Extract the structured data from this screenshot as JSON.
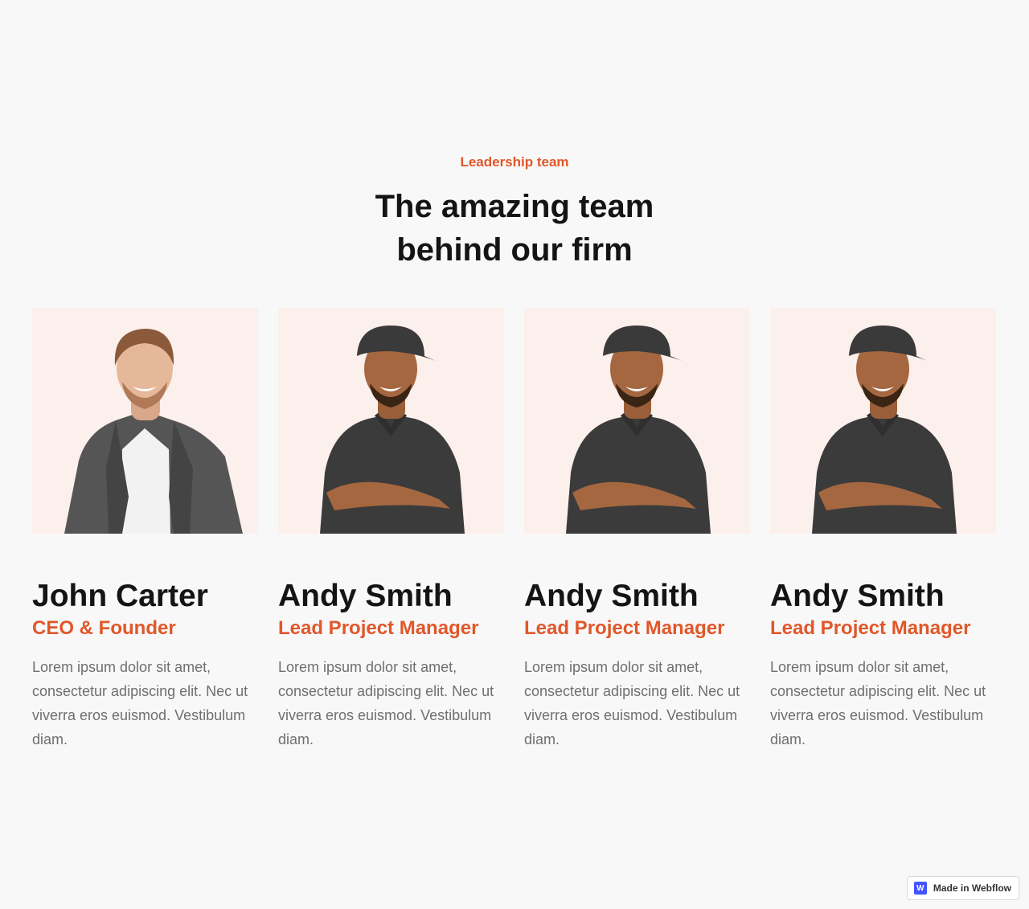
{
  "section": {
    "eyebrow": "Leadership team",
    "heading_line1": "The amazing team",
    "heading_line2": "behind our firm"
  },
  "members": [
    {
      "name": "John Carter",
      "role": "CEO & Founder",
      "bio": "Lorem ipsum dolor sit amet, consectetur adipiscing elit. Nec ut viverra eros euismod. Vestibulum diam.",
      "photo": "man-in-gray-blazer-photo"
    },
    {
      "name": "Andy Smith",
      "role": "Lead Project Manager",
      "bio": "Lorem ipsum dolor sit amet, consectetur adipiscing elit. Nec ut viverra eros euismod. Vestibulum diam.",
      "photo": "man-in-cap-and-polo-photo"
    },
    {
      "name": "Andy Smith",
      "role": "Lead Project Manager",
      "bio": "Lorem ipsum dolor sit amet, consectetur adipiscing elit. Nec ut viverra eros euismod. Vestibulum diam.",
      "photo": "man-in-cap-and-polo-photo"
    },
    {
      "name": "Andy Smith",
      "role": "Lead Project Manager",
      "bio": "Lorem ipsum dolor sit amet, consectetur adipiscing elit. Nec ut viverra eros euismod. Vestibulum diam.",
      "photo": "man-in-cap-and-polo-photo"
    }
  ],
  "badge": {
    "logo_letter": "W",
    "label": "Made in Webflow"
  },
  "colors": {
    "accent": "#e0572a",
    "heading": "#141414",
    "body_text": "#6f6f6f",
    "background": "#f8f8f8",
    "photo_background": "#fcf0ed",
    "webflow_blue": "#4353ff"
  }
}
